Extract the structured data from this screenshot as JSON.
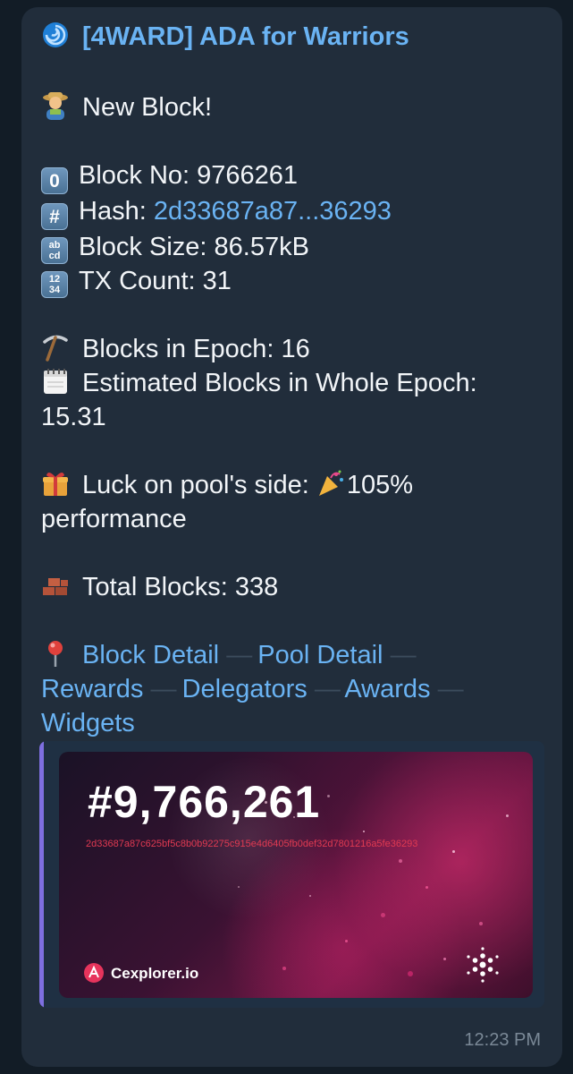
{
  "message": {
    "title": "[4WARD] ADA for Warriors",
    "new_block": "New Block!",
    "block_no_label": "Block No: 9766261",
    "hash_label": "Hash: ",
    "hash_value": "2d33687a87...36293",
    "block_size": "Block Size: 86.57kB",
    "tx_count": "TX Count: 31",
    "blocks_in_epoch": "Blocks in Epoch: 16",
    "estimated_blocks_1": "Estimated Blocks in Whole Epoch:",
    "estimated_blocks_2": "15.31",
    "luck_1": "Luck on pool's side: ",
    "luck_pct": "105%",
    "luck_2": "performance",
    "total_blocks": "Total Blocks: 338",
    "links": {
      "block_detail": "Block Detail",
      "pool_detail": "Pool Detail",
      "rewards": "Rewards",
      "delegators": "Delegators",
      "awards": "Awards",
      "widgets": "Widgets",
      "separator": "—"
    },
    "timestamp": "12:23 PM"
  },
  "preview": {
    "block_number": "#9,766,261",
    "block_hash": "2d33687a87c625bf5c8b0b92275c915e4d6405fb0def32d7801216a5fe36293",
    "site": "Cexplorer.io"
  },
  "colors": {
    "bubble": "#212d3b",
    "link": "#6ab3f3",
    "accent_bar": "#7e6fe0",
    "cexplorer_red": "#e6345c"
  },
  "icons": [
    "cyclone-icon",
    "farmer-icon",
    "keycap-0-icon",
    "keycap-hash-icon",
    "abcd-icon",
    "1234-icon",
    "pick-icon",
    "calendar-icon",
    "gift-icon",
    "party-popper-icon",
    "bricks-icon",
    "round-pushpin-icon",
    "cardano-icon"
  ]
}
